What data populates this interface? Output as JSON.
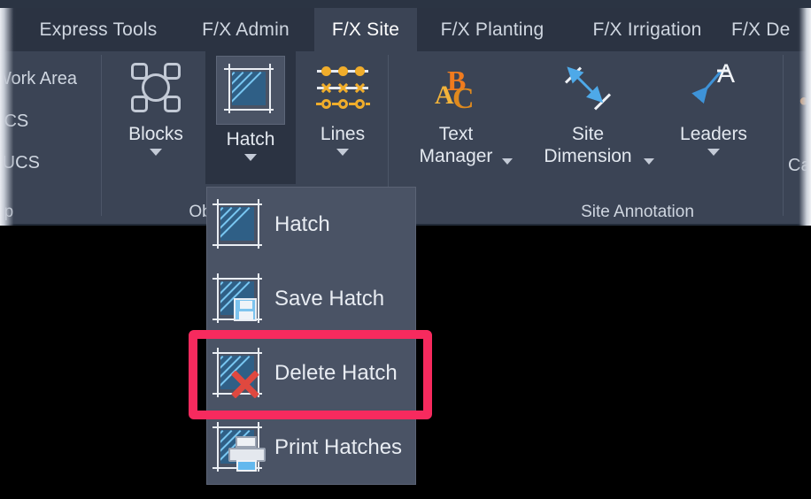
{
  "app": {
    "theme_bg": "#3b4455",
    "tabstrip_bg": "#2b3342",
    "accent_orange": "#f0ad2b",
    "accent_blue": "#4ea9e8",
    "annotation_color": "#f72a5e"
  },
  "ribbon_tabs": [
    {
      "label": "Express Tools",
      "active": false
    },
    {
      "label": "F/X Admin",
      "active": false
    },
    {
      "label": "F/X Site",
      "active": true
    },
    {
      "label": "F/X Planting",
      "active": false
    },
    {
      "label": "F/X Irrigation",
      "active": false
    },
    {
      "label": "F/X De",
      "active": false,
      "truncated": true
    }
  ],
  "left_panel": {
    "clipped_items": [
      {
        "label": "Work Area",
        "icon": "work-area-icon"
      },
      {
        "label": "UCS",
        "icon": "ucs-icon"
      },
      {
        "label": "e UCS",
        "icon": "restore-ucs-icon"
      }
    ],
    "panel_label": "up"
  },
  "objects_panel": {
    "panel_label": "Ob",
    "buttons": [
      {
        "label": "Blocks",
        "icon": "blocks-icon",
        "has_dropdown": true,
        "selected": false
      },
      {
        "label": "Hatch",
        "icon": "hatch-icon",
        "has_dropdown": true,
        "selected": true
      },
      {
        "label": "Lines",
        "icon": "lines-icon",
        "has_dropdown": true,
        "selected": false
      }
    ]
  },
  "site_annotation_panel": {
    "panel_label": "Site Annotation",
    "buttons": [
      {
        "label_line1": "Text",
        "label_line2": "Manager",
        "icon": "abc-text-icon",
        "has_dropdown": true
      },
      {
        "label_line1": "Site",
        "label_line2": "Dimension",
        "icon": "site-dimension-icon",
        "has_dropdown": true
      },
      {
        "label_line1": "Leaders",
        "label_line2": "",
        "icon": "leaders-icon",
        "has_dropdown": true
      }
    ]
  },
  "right_clipped_panel": {
    "label": "Ca"
  },
  "hatch_menu": {
    "items": [
      {
        "label": "Hatch",
        "icon": "hatch-icon",
        "highlighted": false
      },
      {
        "label": "Save Hatch",
        "icon": "save-hatch-icon",
        "highlighted": false
      },
      {
        "label": "Delete Hatch",
        "icon": "delete-hatch-icon",
        "highlighted": true
      },
      {
        "label": "Print Hatches",
        "icon": "print-hatches-icon",
        "highlighted": false
      }
    ]
  },
  "annotation": {
    "target": "Delete Hatch",
    "color": "#f72a5e"
  }
}
